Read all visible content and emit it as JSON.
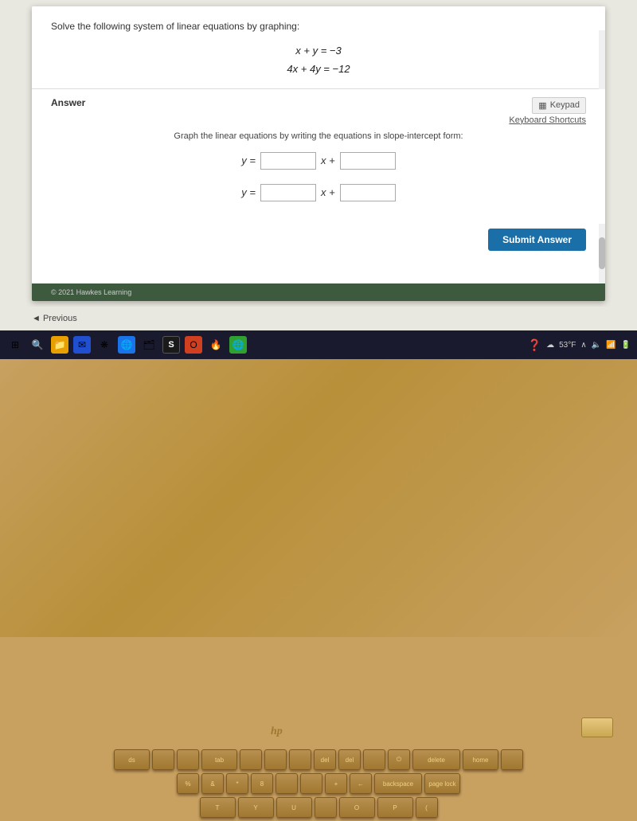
{
  "problem": {
    "instruction": "Solve the following system of linear equations by graphing:",
    "eq1": "x + y  =  −3",
    "eq2": "4x + 4y  =  −12"
  },
  "answer": {
    "label": "Answer",
    "keypad_label": "Keypad",
    "keyboard_shortcuts": "Keyboard Shortcuts",
    "graph_instruction": "Graph the linear equations by writing the equations in slope-intercept form:",
    "eq_row1_prefix": "y =",
    "eq_row1_middle": "x +",
    "eq_row2_prefix": "y =",
    "eq_row2_middle": "x +",
    "submit_label": "Submit Answer"
  },
  "footer": {
    "copyright": "© 2021 Hawkes Learning"
  },
  "nav": {
    "previous_label": "◄ Previous"
  },
  "taskbar": {
    "temperature": "53°F",
    "icons": [
      "⊞",
      "🗔",
      "📁",
      "✉",
      "❋",
      "🌐",
      "🗂",
      "S",
      "O",
      "🔥",
      "🌐"
    ]
  },
  "keyboard": {
    "rows": [
      [
        "ds",
        "",
        "",
        "tab",
        "",
        "",
        "del",
        "del",
        "",
        "⏻",
        "delete",
        "home",
        ""
      ],
      [
        "%",
        "&",
        "*",
        "8",
        "",
        "",
        "+",
        "←",
        "backspace",
        "page lock"
      ],
      [
        "T",
        "Y",
        "U",
        "O",
        "P",
        "("
      ]
    ]
  },
  "hp_logo": "hp"
}
